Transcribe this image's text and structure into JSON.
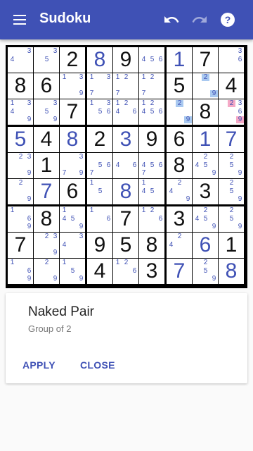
{
  "app": {
    "title": "Sudoku"
  },
  "board": {
    "grid": [
      [
        0,
        0,
        2,
        8,
        9,
        0,
        1,
        7,
        0
      ],
      [
        8,
        6,
        0,
        0,
        0,
        0,
        5,
        0,
        4
      ],
      [
        0,
        0,
        7,
        0,
        0,
        0,
        0,
        8,
        0
      ],
      [
        5,
        4,
        8,
        2,
        3,
        9,
        6,
        1,
        7
      ],
      [
        0,
        1,
        0,
        0,
        0,
        0,
        8,
        0,
        0
      ],
      [
        0,
        7,
        6,
        0,
        8,
        0,
        0,
        3,
        0
      ],
      [
        0,
        8,
        0,
        0,
        7,
        0,
        3,
        0,
        0
      ],
      [
        7,
        0,
        0,
        9,
        5,
        8,
        0,
        6,
        1
      ],
      [
        0,
        0,
        0,
        4,
        0,
        3,
        7,
        0,
        8
      ]
    ],
    "user_cells": [
      [
        0,
        3
      ],
      [
        0,
        6
      ],
      [
        3,
        0
      ],
      [
        3,
        2
      ],
      [
        3,
        4
      ],
      [
        3,
        7
      ],
      [
        3,
        8
      ],
      [
        5,
        1
      ],
      [
        5,
        4
      ],
      [
        7,
        7
      ],
      [
        8,
        6
      ],
      [
        8,
        8
      ]
    ],
    "candidates": [
      [
        [
          3,
          4
        ],
        [
          3,
          5
        ],
        [],
        [],
        [],
        [
          4,
          5,
          6
        ],
        [],
        [],
        [
          3,
          6
        ]
      ],
      [
        [],
        [],
        [
          1,
          3,
          9
        ],
        [
          1,
          3,
          7
        ],
        [
          1,
          2,
          7
        ],
        [
          1,
          2,
          7
        ],
        [],
        [
          2,
          9
        ],
        []
      ],
      [
        [
          1,
          3,
          4,
          9
        ],
        [
          3,
          5,
          9
        ],
        [],
        [
          1,
          3,
          5,
          6
        ],
        [
          1,
          2,
          4,
          6
        ],
        [
          1,
          2,
          4,
          5,
          6
        ],
        [
          2,
          9
        ],
        [],
        [
          2,
          3,
          6,
          9
        ]
      ],
      [
        [],
        [],
        [],
        [],
        [],
        [],
        [],
        [],
        []
      ],
      [
        [
          2,
          3,
          9
        ],
        [],
        [
          3,
          9,
          7
        ],
        [
          5,
          6,
          7
        ],
        [
          4,
          6
        ],
        [
          4,
          5,
          6,
          7
        ],
        [],
        [
          2,
          4,
          5,
          9
        ],
        [
          2,
          5,
          9
        ]
      ],
      [
        [
          2,
          9
        ],
        [],
        [],
        [
          1,
          5
        ],
        [],
        [
          1,
          4,
          5
        ],
        [
          2,
          4,
          9
        ],
        [],
        [
          2,
          5,
          9
        ]
      ],
      [
        [
          1,
          6,
          9
        ],
        [],
        [
          1,
          4,
          5,
          9
        ],
        [
          1,
          6
        ],
        [],
        [
          1,
          2,
          6
        ],
        [],
        [
          2,
          4,
          5,
          9
        ],
        [
          2,
          5,
          9
        ]
      ],
      [
        [],
        [
          2,
          3,
          9
        ],
        [
          3,
          4
        ],
        [],
        [],
        [],
        [
          2,
          4
        ],
        [],
        []
      ],
      [
        [
          1,
          6,
          9
        ],
        [
          2,
          9
        ],
        [
          1,
          5,
          9
        ],
        [],
        [
          1,
          2,
          6
        ],
        [],
        [],
        [
          2,
          5,
          9
        ],
        []
      ]
    ],
    "highlights": [
      {
        "row": 1,
        "col": 7,
        "digit": 2,
        "color": "blue"
      },
      {
        "row": 1,
        "col": 7,
        "digit": 9,
        "color": "blue"
      },
      {
        "row": 2,
        "col": 6,
        "digit": 2,
        "color": "blue"
      },
      {
        "row": 2,
        "col": 6,
        "digit": 9,
        "color": "blue"
      },
      {
        "row": 2,
        "col": 8,
        "digit": 2,
        "color": "pink"
      },
      {
        "row": 2,
        "col": 8,
        "digit": 9,
        "color": "pink"
      }
    ]
  },
  "hint_card": {
    "title": "Naked Pair",
    "subtitle": "Group of 2",
    "apply_label": "APPLY",
    "close_label": "CLOSE"
  },
  "colors": {
    "primary": "#3f51b5",
    "highlight_blue": "#a9c9f0",
    "highlight_pink": "#f5a9c6"
  },
  "icons": {
    "menu": "menu-icon",
    "undo": "undo-icon",
    "redo": "redo-icon",
    "help": "help-icon"
  }
}
